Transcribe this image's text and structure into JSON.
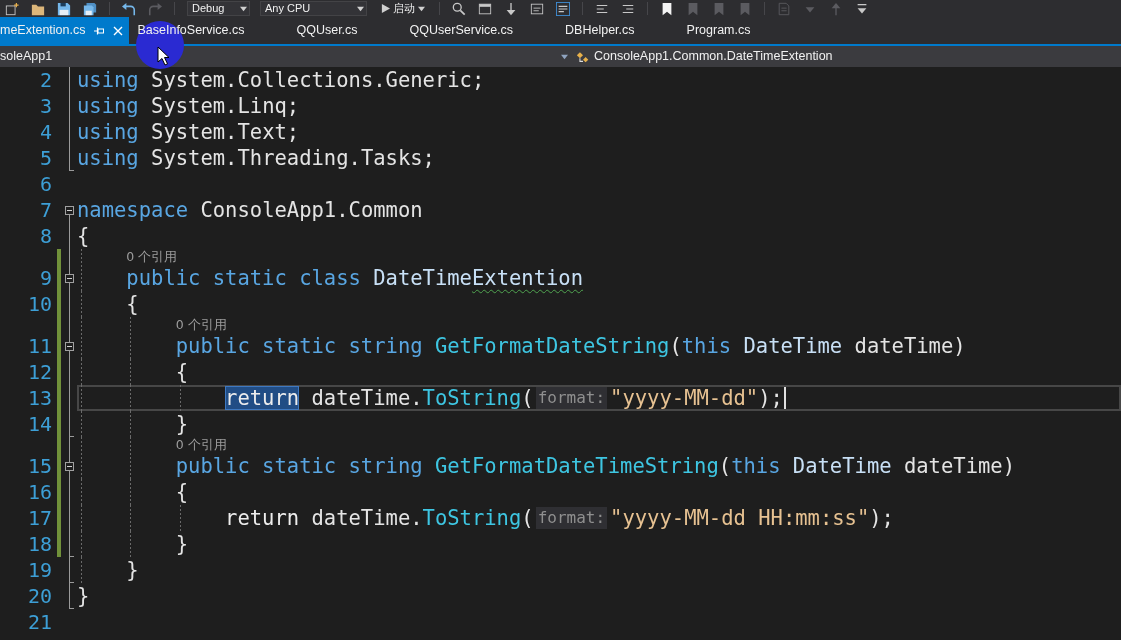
{
  "toolbar": {
    "left_buttons": [
      {
        "disabled": false
      },
      {
        "disabled": false
      },
      {
        "disabled": false
      },
      {
        "disabled": false
      },
      {
        "disabled": false
      },
      {
        "disabled": true
      }
    ],
    "configuration": "Debug",
    "platform": "Any CPU",
    "start": "启动",
    "right_buttons": [
      {
        "disabled": false
      },
      {
        "disabled": false
      },
      {
        "disabled": false
      },
      {
        "disabled": false
      },
      {
        "disabled": false
      },
      {
        "disabled": false
      },
      {
        "disabled": false
      },
      {
        "disabled": false
      },
      {
        "disabled": true
      },
      {
        "disabled": true
      },
      {
        "disabled": true
      },
      {
        "disabled": true
      },
      {
        "disabled": true
      },
      {
        "disabled": true
      },
      {
        "disabled": false
      }
    ]
  },
  "tabs": [
    {
      "label": "meExtention.cs",
      "selected": true
    },
    {
      "label": "BaseInfoService.cs",
      "selected": false
    },
    {
      "label": "QQUser.cs",
      "selected": false
    },
    {
      "label": "QQUserService.cs",
      "selected": false
    },
    {
      "label": "DBHelper.cs",
      "selected": false
    },
    {
      "label": "Program.cs",
      "selected": false
    }
  ],
  "navigation_bar": {
    "project": "soleApp1",
    "type": "ConsoleApp1.Common.DateTimeExtention"
  },
  "editor": {
    "lines": [
      {
        "number": "2",
        "kind": "inner",
        "changed": false,
        "current": false,
        "tokens": [
          {
            "kind": "keyword",
            "text": "using",
            "selected": false
          },
          {
            "kind": "plain",
            "text": " System.Collections.Generic;",
            "selected": false
          }
        ]
      },
      {
        "number": "3",
        "kind": "inner",
        "changed": false,
        "current": false,
        "tokens": [
          {
            "kind": "keyword",
            "text": "using",
            "selected": false
          },
          {
            "kind": "plain",
            "text": " System.Linq;",
            "selected": false
          }
        ]
      },
      {
        "number": "4",
        "kind": "inner",
        "changed": false,
        "current": false,
        "tokens": [
          {
            "kind": "keyword",
            "text": "using",
            "selected": false
          },
          {
            "kind": "plain",
            "text": " System.Text;",
            "selected": false
          }
        ]
      },
      {
        "number": "5",
        "kind": "closer",
        "changed": false,
        "current": false,
        "tokens": [
          {
            "kind": "keyword",
            "text": "using",
            "selected": false
          },
          {
            "kind": "plain",
            "text": " System.Threading.Tasks;",
            "selected": false
          }
        ]
      },
      {
        "number": "6",
        "kind": "plain",
        "changed": false,
        "current": false
      },
      {
        "number": "7",
        "kind": "opener",
        "changed": false,
        "current": false,
        "tokens": [
          {
            "kind": "keyword",
            "text": "namespace",
            "selected": false
          },
          {
            "kind": "plain",
            "text": " ConsoleApp1.Common",
            "selected": false
          }
        ]
      },
      {
        "number": "8",
        "kind": "inner",
        "changed": false,
        "current": false,
        "tokens": [
          {
            "kind": "plain",
            "text": "{",
            "selected": false
          }
        ],
        "children": [
          {
            "number": "9",
            "codelens": "0 个引用",
            "kind": "opener",
            "changed": true,
            "current": false,
            "tokens": [
              {
                "kind": "keyword",
                "text": "public static class",
                "selected": false
              },
              {
                "kind": "type",
                "text": " DateTime",
                "selected": false
              },
              {
                "kind": "misspelled",
                "text": "Extention",
                "selected": false
              }
            ]
          },
          {
            "number": "10",
            "kind": "inner",
            "changed": true,
            "current": false,
            "tokens": [
              {
                "kind": "plain",
                "text": "{",
                "selected": false
              }
            ],
            "children": [
              {
                "number": "11",
                "codelens": "0 个引用",
                "kind": "opener",
                "changed": true,
                "current": false,
                "tokens": [
                  {
                    "kind": "keyword",
                    "text": "public static string",
                    "selected": false
                  },
                  {
                    "kind": "method",
                    "text": " GetFormatDateString",
                    "selected": false
                  },
                  {
                    "kind": "plain",
                    "text": "(",
                    "selected": false
                  },
                  {
                    "kind": "keyword",
                    "text": "this",
                    "selected": false
                  },
                  {
                    "kind": "type",
                    "text": " DateTime",
                    "selected": false
                  },
                  {
                    "kind": "plain",
                    "text": " dateTime)",
                    "selected": false
                  }
                ]
              },
              {
                "number": "12",
                "kind": "inner",
                "changed": true,
                "current": false,
                "tokens": [
                  {
                    "kind": "plain",
                    "text": "{",
                    "selected": false
                  }
                ],
                "children": [
                  {
                    "number": "13",
                    "kind": "inner",
                    "changed": true,
                    "current": true,
                    "tokens": [
                      {
                        "kind": "control",
                        "text": "return",
                        "selected": true
                      },
                      {
                        "kind": "plain",
                        "text": " dateTime.",
                        "selected": false
                      },
                      {
                        "kind": "method",
                        "text": "ToString",
                        "selected": false
                      },
                      {
                        "kind": "plain",
                        "text": "(",
                        "selected": false
                      },
                      {
                        "kind": "hint",
                        "text": "format:",
                        "selected": false
                      },
                      {
                        "kind": "string",
                        "text": "\"yyyy-MM-dd\"",
                        "selected": false
                      },
                      {
                        "kind": "plain",
                        "text": ");",
                        "selected": false
                      }
                    ]
                  }
                ]
              },
              {
                "number": "14",
                "kind": "closer",
                "changed": true,
                "current": false,
                "tokens": [
                  {
                    "kind": "plain",
                    "text": "}",
                    "selected": false
                  }
                ]
              },
              {
                "number": "15",
                "codelens": "0 个引用",
                "kind": "opener",
                "changed": true,
                "current": false,
                "tokens": [
                  {
                    "kind": "keyword",
                    "text": "public static string",
                    "selected": false
                  },
                  {
                    "kind": "method",
                    "text": " GetFormatDateTimeString",
                    "selected": false
                  },
                  {
                    "kind": "plain",
                    "text": "(",
                    "selected": false
                  },
                  {
                    "kind": "keyword",
                    "text": "this",
                    "selected": false
                  },
                  {
                    "kind": "type",
                    "text": " DateTime",
                    "selected": false
                  },
                  {
                    "kind": "plain",
                    "text": " dateTime)",
                    "selected": false
                  }
                ]
              },
              {
                "number": "16",
                "kind": "inner",
                "changed": true,
                "current": false,
                "tokens": [
                  {
                    "kind": "plain",
                    "text": "{",
                    "selected": false
                  }
                ],
                "children": [
                  {
                    "number": "17",
                    "kind": "inner",
                    "changed": true,
                    "current": false,
                    "tokens": [
                      {
                        "kind": "control",
                        "text": "return",
                        "selected": false
                      },
                      {
                        "kind": "plain",
                        "text": " dateTime.",
                        "selected": false
                      },
                      {
                        "kind": "method",
                        "text": "ToString",
                        "selected": false
                      },
                      {
                        "kind": "plain",
                        "text": "(",
                        "selected": false
                      },
                      {
                        "kind": "hint",
                        "text": "format:",
                        "selected": false
                      },
                      {
                        "kind": "string",
                        "text": "\"yyyy-MM-dd HH:mm:ss\"",
                        "selected": false
                      },
                      {
                        "kind": "plain",
                        "text": ");",
                        "selected": false
                      }
                    ]
                  }
                ]
              },
              {
                "number": "18",
                "kind": "closer",
                "changed": true,
                "current": false,
                "tokens": [
                  {
                    "kind": "plain",
                    "text": "}",
                    "selected": false
                  }
                ]
              }
            ]
          },
          {
            "number": "19",
            "kind": "closer",
            "changed": false,
            "current": false,
            "tokens": [
              {
                "kind": "plain",
                "text": "}",
                "selected": false
              }
            ]
          }
        ]
      },
      {
        "number": "20",
        "kind": "closer",
        "changed": false,
        "current": false,
        "tokens": [
          {
            "kind": "plain",
            "text": "}",
            "selected": false
          }
        ]
      },
      {
        "number": "21",
        "kind": "plain",
        "changed": false,
        "current": false
      }
    ]
  }
}
